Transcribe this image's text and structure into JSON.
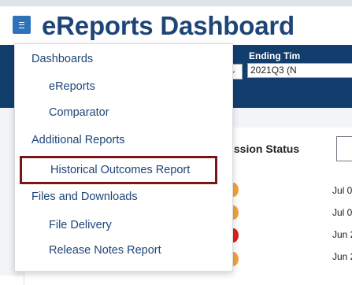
{
  "header": {
    "title": "eReports Dashboard"
  },
  "controls": {
    "ending_label": "Ending Tim",
    "ending_value": "2021Q3 (N",
    "start_chevron": "⌄"
  },
  "status": {
    "heading": "ission Status"
  },
  "timeline": {
    "dates": [
      "Jul 0",
      "Jul 0",
      "Jun 2",
      "Jun 2"
    ]
  },
  "menu": {
    "sections": [
      {
        "label": "Dashboards",
        "items": [
          "eReports",
          "Comparator"
        ]
      },
      {
        "label": "Additional Reports",
        "items": [
          "Historical Outcomes Report"
        ]
      },
      {
        "label": "Files and Downloads",
        "items": [
          "File Delivery",
          "Release Notes Report"
        ]
      }
    ],
    "highlighted_item": "Historical Outcomes Report"
  },
  "colors": {
    "brand_blue": "#1d4577",
    "hamburger_blue": "#2e73b8",
    "bar_navy": "#123e6e",
    "highlight_border": "#7b1416",
    "status_orange": "#f4a23c",
    "status_red": "#e02020"
  },
  "icons": {
    "menu_toggle": "hamburger-icon",
    "dropdown": "chevron-down-icon"
  }
}
